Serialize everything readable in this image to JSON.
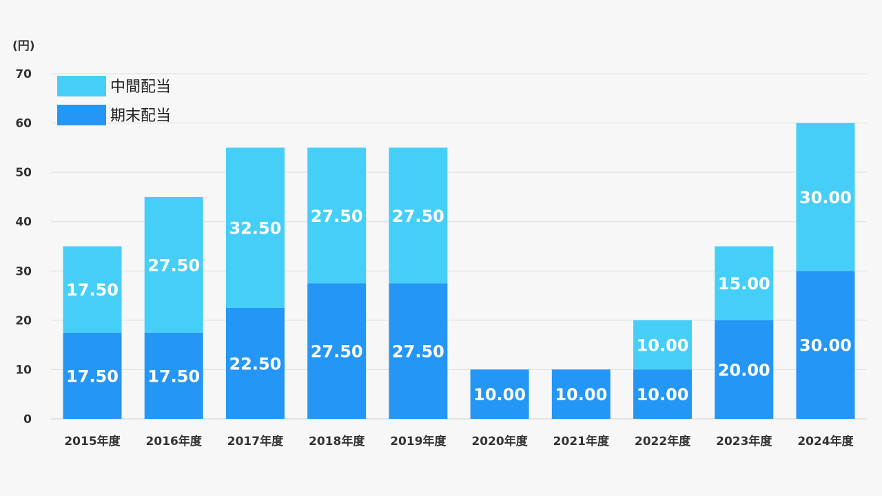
{
  "chart_data": {
    "type": "bar",
    "stacked": true,
    "unit_label": "(円)",
    "categories": [
      "2015年度",
      "2016年度",
      "2017年度",
      "2018年度",
      "2019年度",
      "2020年度",
      "2021年度",
      "2022年度",
      "2023年度",
      "2024年度"
    ],
    "series": [
      {
        "name": "期末配当",
        "color": "#2496f5",
        "values": [
          17.5,
          17.5,
          22.5,
          27.5,
          27.5,
          10,
          10,
          10,
          20,
          30
        ],
        "labels": [
          "17.50",
          "17.50",
          "22.50",
          "27.50",
          "27.50",
          "10.00",
          "10.00",
          "10.00",
          "20.00",
          "30.00"
        ]
      },
      {
        "name": "中間配当",
        "color": "#45cff8",
        "values": [
          17.5,
          27.5,
          32.5,
          27.5,
          27.5,
          0,
          0,
          10,
          15,
          30
        ],
        "labels": [
          "17.50",
          "27.50",
          "32.50",
          "27.50",
          "27.50",
          "",
          "",
          "10.00",
          "15.00",
          "30.00"
        ]
      }
    ],
    "y_ticks": [
      "0",
      "10",
      "20",
      "30",
      "40",
      "50",
      "60",
      "70"
    ],
    "ylim": [
      0,
      70
    ],
    "grid": true,
    "legend": {
      "placement": "top-left",
      "items": [
        {
          "name": "中間配当",
          "color": "#45cff8"
        },
        {
          "name": "期末配当",
          "color": "#2496f5"
        }
      ]
    }
  }
}
